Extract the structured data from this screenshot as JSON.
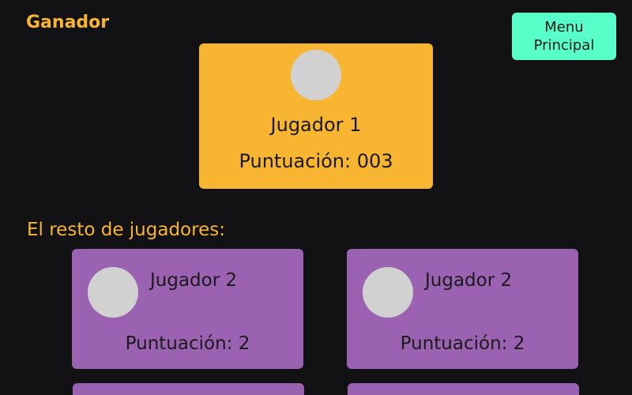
{
  "header": {
    "title": "Ganador",
    "menu_line1": "Menu",
    "menu_line2": "Principal"
  },
  "winner": {
    "name": "Jugador 1",
    "score": "Puntuación: 003"
  },
  "rest": {
    "heading": "El resto de jugadores:",
    "players": [
      {
        "name": "Jugador 2",
        "score": "Puntuación: 2"
      },
      {
        "name": "Jugador 2",
        "score": "Puntuación: 2"
      }
    ]
  },
  "colors": {
    "background": "#121113",
    "accent": "#f8b531",
    "menu_button": "#58ffc8",
    "player_card": "#9b62b2",
    "avatar": "#d1d1d1"
  },
  "icons": {
    "avatar": "avatar-placeholder-icon"
  }
}
